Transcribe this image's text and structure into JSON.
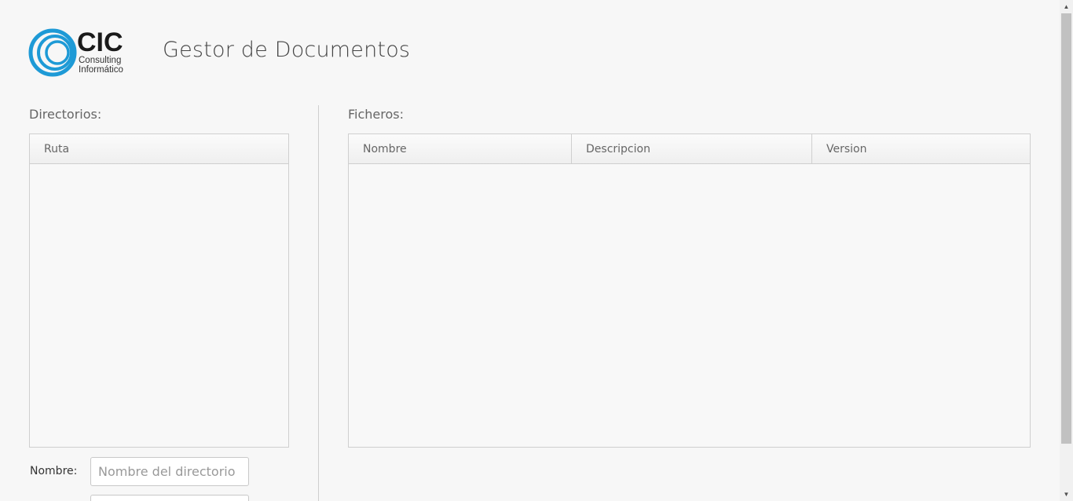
{
  "header": {
    "logo_text": "CIC",
    "logo_sub_1": "Consulting",
    "logo_sub_2": "Informático",
    "title": "Gestor de Documentos"
  },
  "directories": {
    "label": "Directorios:",
    "columns": [
      "Ruta"
    ],
    "rows": []
  },
  "files": {
    "label": "Ficheros:",
    "columns": [
      "Nombre",
      "Descripcion",
      "Version"
    ],
    "rows": []
  },
  "form": {
    "name_label": "Nombre:",
    "name_placeholder": "Nombre del directorio",
    "name_value": ""
  },
  "colors": {
    "background": "#f7f7f7",
    "border": "#cfcfcf",
    "logo_blue": "#1e9ad6"
  },
  "icons": {
    "scroll_up": "up-arrow-icon",
    "scroll_down": "down-arrow-icon"
  }
}
